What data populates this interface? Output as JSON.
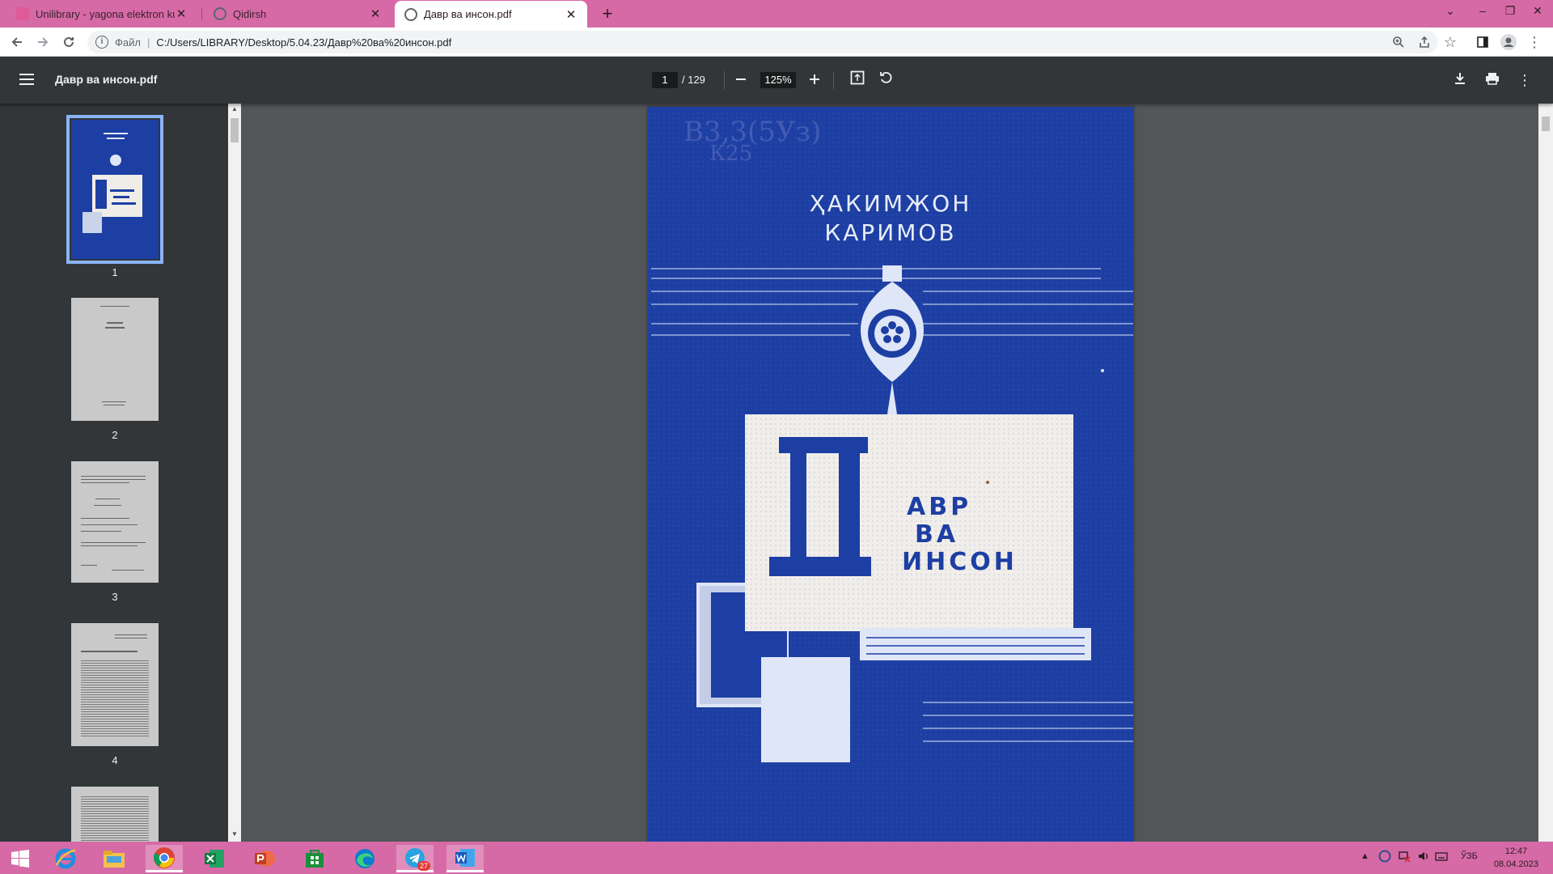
{
  "browser": {
    "tabs": [
      {
        "title": "Unilibrary - yagona elektron kutu",
        "favicon": "book-icon",
        "state": "inactive"
      },
      {
        "title": "Qidirsh",
        "favicon": "globe-icon",
        "state": "inactive"
      },
      {
        "title": "Давр ва инсон.pdf",
        "favicon": "globe-icon",
        "state": "active"
      }
    ],
    "address": {
      "protocol_label": "Файл",
      "url": "C:/Users/LIBRARY/Desktop/5.04.23/Давр%20ва%20инсон.pdf"
    }
  },
  "pdf_viewer": {
    "title": "Давр ва инсон.pdf",
    "current_page": "1",
    "total_pages": "/ 129",
    "zoom": "125%",
    "thumbnails": [
      {
        "number": "1"
      },
      {
        "number": "2"
      },
      {
        "number": "3"
      },
      {
        "number": "4"
      }
    ]
  },
  "cover": {
    "handwritten_code": "В3,3(5Уз)\nК25",
    "author_line1": "ҲАКИМЖОН",
    "author_line2": "КАРИМОВ",
    "big_letter": "Д",
    "title_line1": "АВР",
    "title_line2": "ВА",
    "title_line3": "ИНСОН"
  },
  "taskbar": {
    "language": "ЎЗБ",
    "time": "12:47",
    "date": "08.04.2023",
    "telegram_badge": "27"
  },
  "colors": {
    "tabstrip": "#d66aa6",
    "cover_blue": "#1d3fa3",
    "viewer_dark": "#323639"
  }
}
